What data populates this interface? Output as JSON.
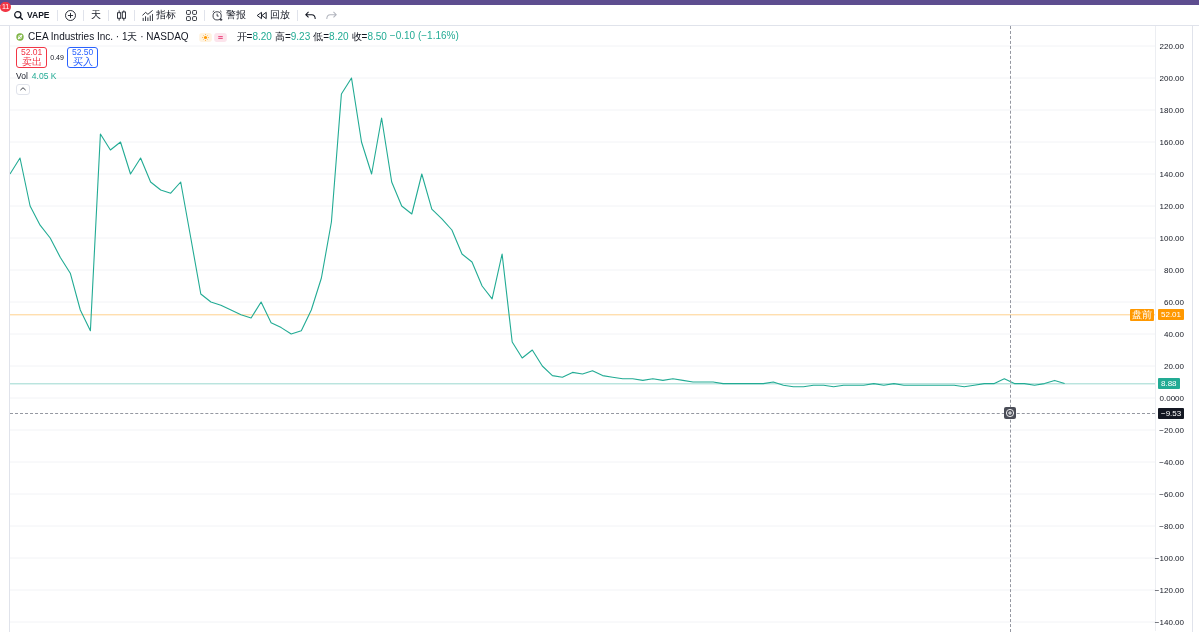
{
  "notification_badge": "11",
  "toolbar": {
    "items": [
      {
        "kind": "symbol_search",
        "label": "VAPE",
        "disabled": false
      },
      {
        "kind": "divider"
      },
      {
        "kind": "compare",
        "disabled": false
      },
      {
        "kind": "divider"
      },
      {
        "kind": "interval",
        "label": "天",
        "disabled": false
      },
      {
        "kind": "divider"
      },
      {
        "kind": "chart_style",
        "disabled": false
      },
      {
        "kind": "divider"
      },
      {
        "kind": "indicators",
        "label": "指标",
        "disabled": false
      },
      {
        "kind": "layouts",
        "disabled": false
      },
      {
        "kind": "divider"
      },
      {
        "kind": "alert",
        "label": "警报",
        "disabled": false
      },
      {
        "kind": "replay",
        "label": "回放",
        "disabled": false
      },
      {
        "kind": "divider"
      },
      {
        "kind": "undo",
        "disabled": false
      },
      {
        "kind": "redo",
        "disabled": true
      }
    ]
  },
  "chart": {
    "legend": {
      "title": "CEA Industries Inc. · 1天 · NASDAQ",
      "status_badges": [
        {
          "kind": "sun"
        },
        {
          "kind": "equals"
        }
      ],
      "ohlc": [
        {
          "label": "开=",
          "value": "8.20"
        },
        {
          "label": "高=",
          "value": "9.23"
        },
        {
          "label": "低=",
          "value": "8.20"
        },
        {
          "label": "收=",
          "value": "8.50"
        }
      ],
      "change": "−0.10 (−1.16%)",
      "sell": {
        "price": "52.01",
        "label": "卖出"
      },
      "spread": "0.49",
      "buy": {
        "price": "52.50",
        "label": "买入"
      },
      "volume": {
        "label": "Vol",
        "value": "4.05 K"
      },
      "toggle": {
        "expanded": true
      }
    },
    "crosshair": {
      "label": "−9.53"
    },
    "chart_data": {
      "type": "line",
      "series": [
        {
          "color": "#22ab94",
          "values": [
            140,
            150,
            120,
            108,
            100,
            88,
            78,
            55,
            42,
            165,
            155,
            160,
            140,
            150,
            135,
            130,
            128,
            135,
            100,
            65,
            60,
            58,
            55,
            52,
            50,
            60,
            47,
            44,
            40,
            42,
            55,
            75,
            110,
            190,
            200,
            160,
            140,
            175,
            135,
            120,
            115,
            140,
            118,
            112,
            105,
            90,
            85,
            70,
            62,
            90,
            35,
            25,
            30,
            20,
            14,
            13,
            16,
            15,
            17,
            14,
            13,
            12,
            12,
            11,
            12,
            11,
            12,
            11,
            10,
            10,
            10,
            9,
            9,
            9,
            9,
            9,
            10,
            8,
            7,
            7,
            8,
            8,
            7,
            8,
            8,
            8,
            9,
            8,
            9,
            8,
            8,
            8,
            8,
            8,
            8,
            7,
            8,
            9,
            9,
            12,
            9,
            9,
            8,
            9,
            11,
            9
          ]
        }
      ],
      "ylim": [
        -145.6,
        232.5
      ],
      "yticks": [
        {
          "value": 220,
          "label": "220.00"
        },
        {
          "value": 200,
          "label": "200.00"
        },
        {
          "value": 180,
          "label": "180.00"
        },
        {
          "value": 160,
          "label": "160.00"
        },
        {
          "value": 140,
          "label": "140.00"
        },
        {
          "value": 120,
          "label": "120.00"
        },
        {
          "value": 100,
          "label": "100.00"
        },
        {
          "value": 80,
          "label": "80.00"
        },
        {
          "value": 60,
          "label": "60.00"
        },
        {
          "value": 40,
          "label": "40.00"
        },
        {
          "value": 20,
          "label": "20.00"
        },
        {
          "value": 0,
          "label": "0.0000"
        },
        {
          "value": -20,
          "label": "−20.00"
        },
        {
          "value": -40,
          "label": "−40.00"
        },
        {
          "value": -60,
          "label": "−60.00"
        },
        {
          "value": -80,
          "label": "−80.00"
        },
        {
          "value": -100,
          "label": "−100.00"
        },
        {
          "value": -120,
          "label": "−120.00"
        },
        {
          "value": -140,
          "label": "−140.00"
        }
      ],
      "grid": true,
      "ref_lines": [
        {
          "axis": "y",
          "value": 52.01,
          "label": "52.01",
          "color": "#ff9800"
        },
        {
          "axis": "y",
          "value": 8.88,
          "label": "8.88",
          "color": "#22ab94"
        }
      ],
      "annotations": [
        {
          "text": "盘前",
          "y": 52.01
        }
      ]
    }
  }
}
